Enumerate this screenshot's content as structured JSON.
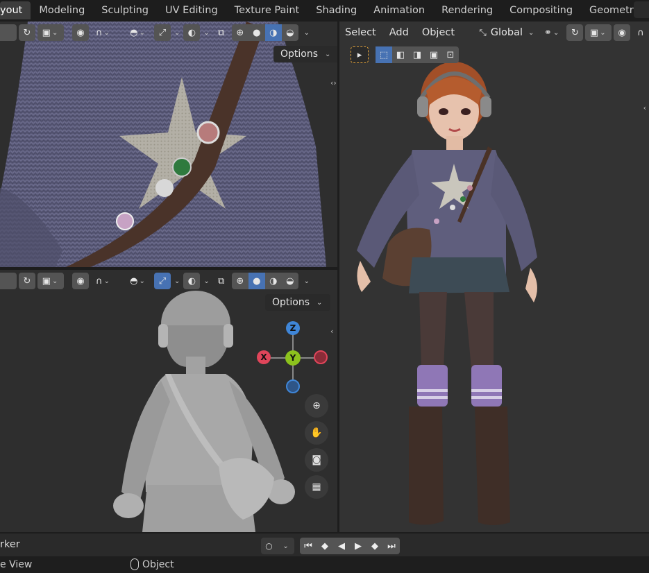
{
  "workspace_tabs": [
    {
      "label": "yout",
      "active": true
    },
    {
      "label": "Modeling"
    },
    {
      "label": "Sculpting"
    },
    {
      "label": "UV Editing"
    },
    {
      "label": "Texture Paint"
    },
    {
      "label": "Shading"
    },
    {
      "label": "Animation"
    },
    {
      "label": "Rendering"
    },
    {
      "label": "Compositing"
    },
    {
      "label": "Geometry Node"
    }
  ],
  "viewport_top_left": {
    "options_label": "Options"
  },
  "viewport_bottom_left": {
    "options_label": "Options"
  },
  "viewport_right": {
    "menu": {
      "select": "Select",
      "add": "Add",
      "object": "Object"
    },
    "transform_orientation": "Global"
  },
  "gizmo": {
    "x": "X",
    "y": "Y",
    "z": "Z"
  },
  "timeline": {
    "marker_label": "rker"
  },
  "statusbar": {
    "left": "e View",
    "mode": "Object"
  },
  "colors": {
    "accent": "#4772b3",
    "axis_x": "#e0455a",
    "axis_y": "#8cc21d",
    "axis_z": "#3f86d8",
    "panel_bg": "#2e2e2e"
  },
  "icons": [
    "orientation-icon",
    "viewpoint-icon",
    "proportional-icon",
    "falloff-icon",
    "visibility-icon",
    "gizmo-icon",
    "overlay-icon",
    "xray-icon",
    "wireframe-shading-icon",
    "solid-shading-icon",
    "material-shading-icon",
    "rendered-shading-icon",
    "zoom-icon",
    "pan-hand-icon",
    "camera-icon",
    "grid-icon",
    "select-tool-icon",
    "play-icon",
    "jump-start-icon",
    "jump-end-icon",
    "keyframe-prev-icon",
    "keyframe-next-icon",
    "mouse-icon"
  ]
}
